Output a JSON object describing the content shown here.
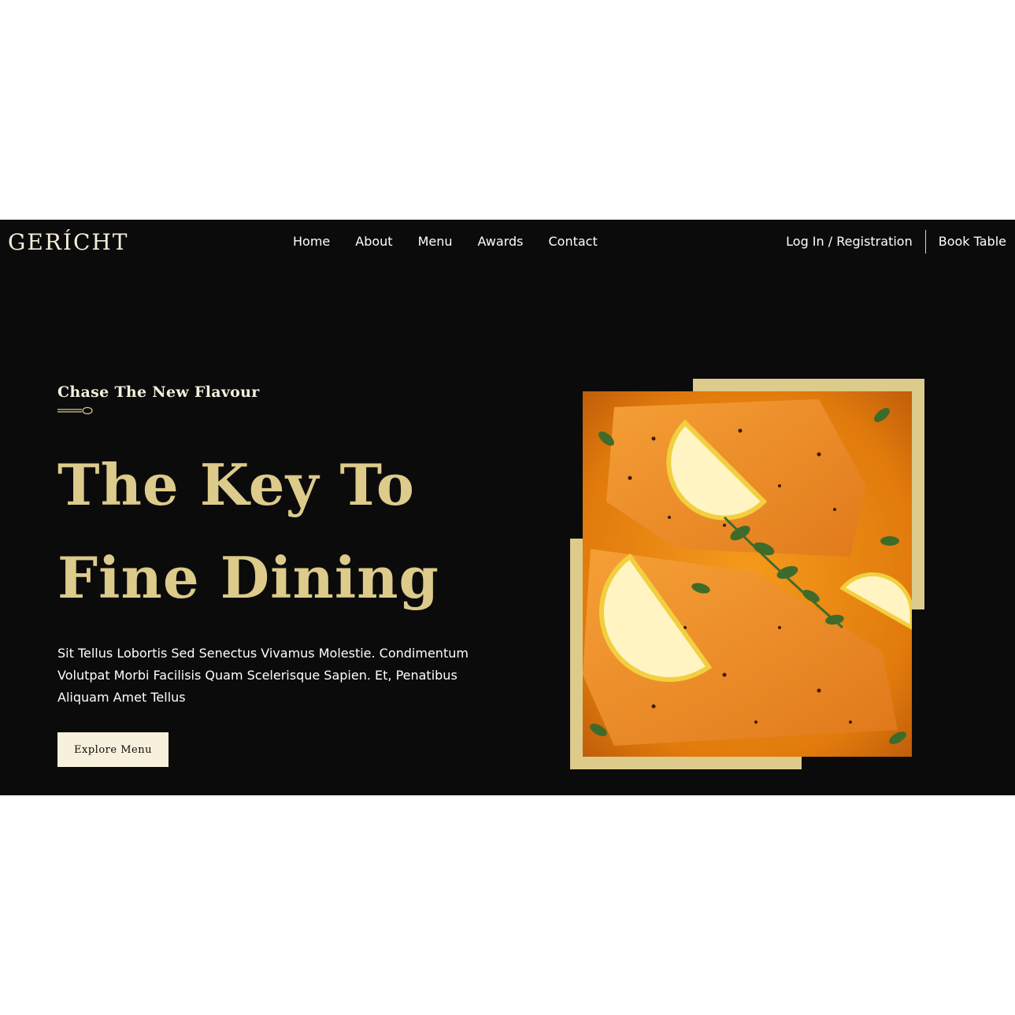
{
  "brand": {
    "logo": "GERÍCHT"
  },
  "nav": {
    "links": [
      "Home",
      "About",
      "Menu",
      "Awards",
      "Contact"
    ],
    "login": "Log In / Registration",
    "book": "Book Table"
  },
  "hero": {
    "subtitle": "Chase The New Flavour",
    "headline_line1": "The Key To",
    "headline_line2": "Fine Dining",
    "description": "Sit Tellus Lobortis Sed Senectus Vivamus Molestie. Condimentum Volutpat Morbi Facilisis Quam Scelerisque Sapien. Et, Penatibus Aliquam Amet Tellus",
    "cta": "Explore Menu"
  },
  "colors": {
    "background": "#0c0b0c",
    "gold": "#dccb8a",
    "cream": "#f5efdb",
    "white": "#ffffff"
  },
  "icons": {
    "subtitle_decoration": "spoon-icon"
  }
}
